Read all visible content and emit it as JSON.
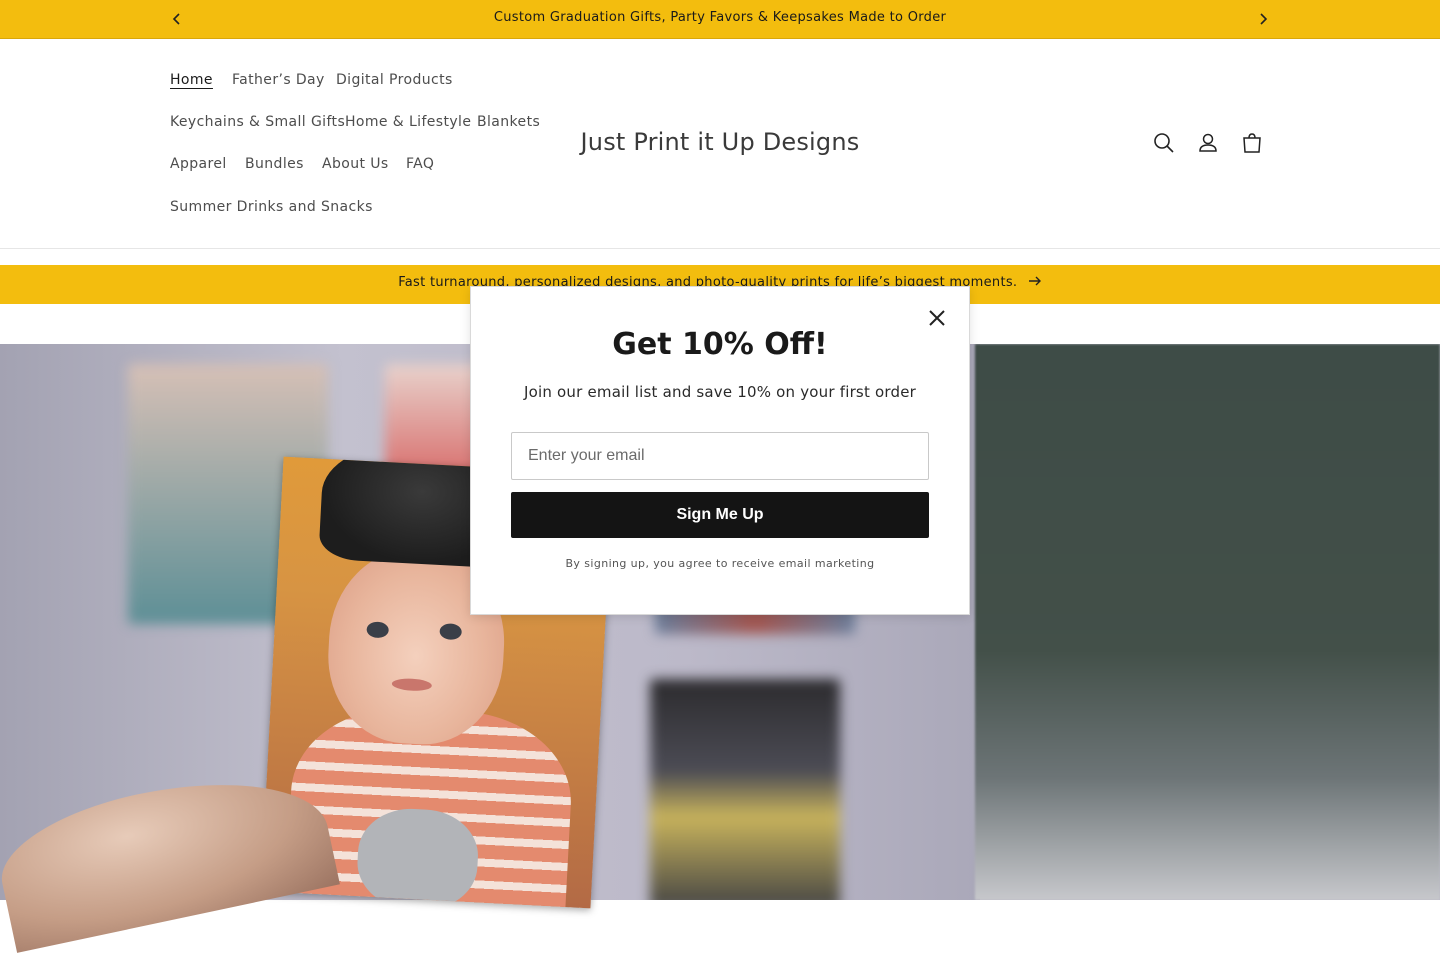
{
  "announcement": {
    "text": "Custom Graduation Gifts, Party Favors & Keepsakes Made to Order",
    "prev_icon": "chevron-left-icon",
    "next_icon": "chevron-right-icon"
  },
  "header": {
    "logo": "Just Print it Up Designs",
    "nav": [
      {
        "label": "Home",
        "active": true
      },
      {
        "label": "Father’s Day"
      },
      {
        "label": "Digital Products"
      },
      {
        "label": "Keychains & Small Gifts"
      },
      {
        "label": "Home & Lifestyle"
      },
      {
        "label": "Blankets"
      },
      {
        "label": "Apparel"
      },
      {
        "label": "Bundles"
      },
      {
        "label": "About Us"
      },
      {
        "label": "FAQ"
      },
      {
        "label": "Summer Drinks and Snacks"
      }
    ],
    "icons": [
      "search-icon",
      "account-icon",
      "cart-icon"
    ]
  },
  "promo": {
    "text": "Fast turnaround, personalized designs, and photo-quality prints for life’s biggest moments.",
    "icon": "arrow-right-icon"
  },
  "modal": {
    "title": "Get 10% Off!",
    "subtitle": "Join our email list and save 10% on your first order",
    "email_placeholder": "Enter your email",
    "button_label": "Sign Me Up",
    "legal": "By signing up, you agree to receive email marketing",
    "close_icon": "close-icon"
  },
  "colors": {
    "accent": "#f3bd0e",
    "button": "#141414"
  }
}
